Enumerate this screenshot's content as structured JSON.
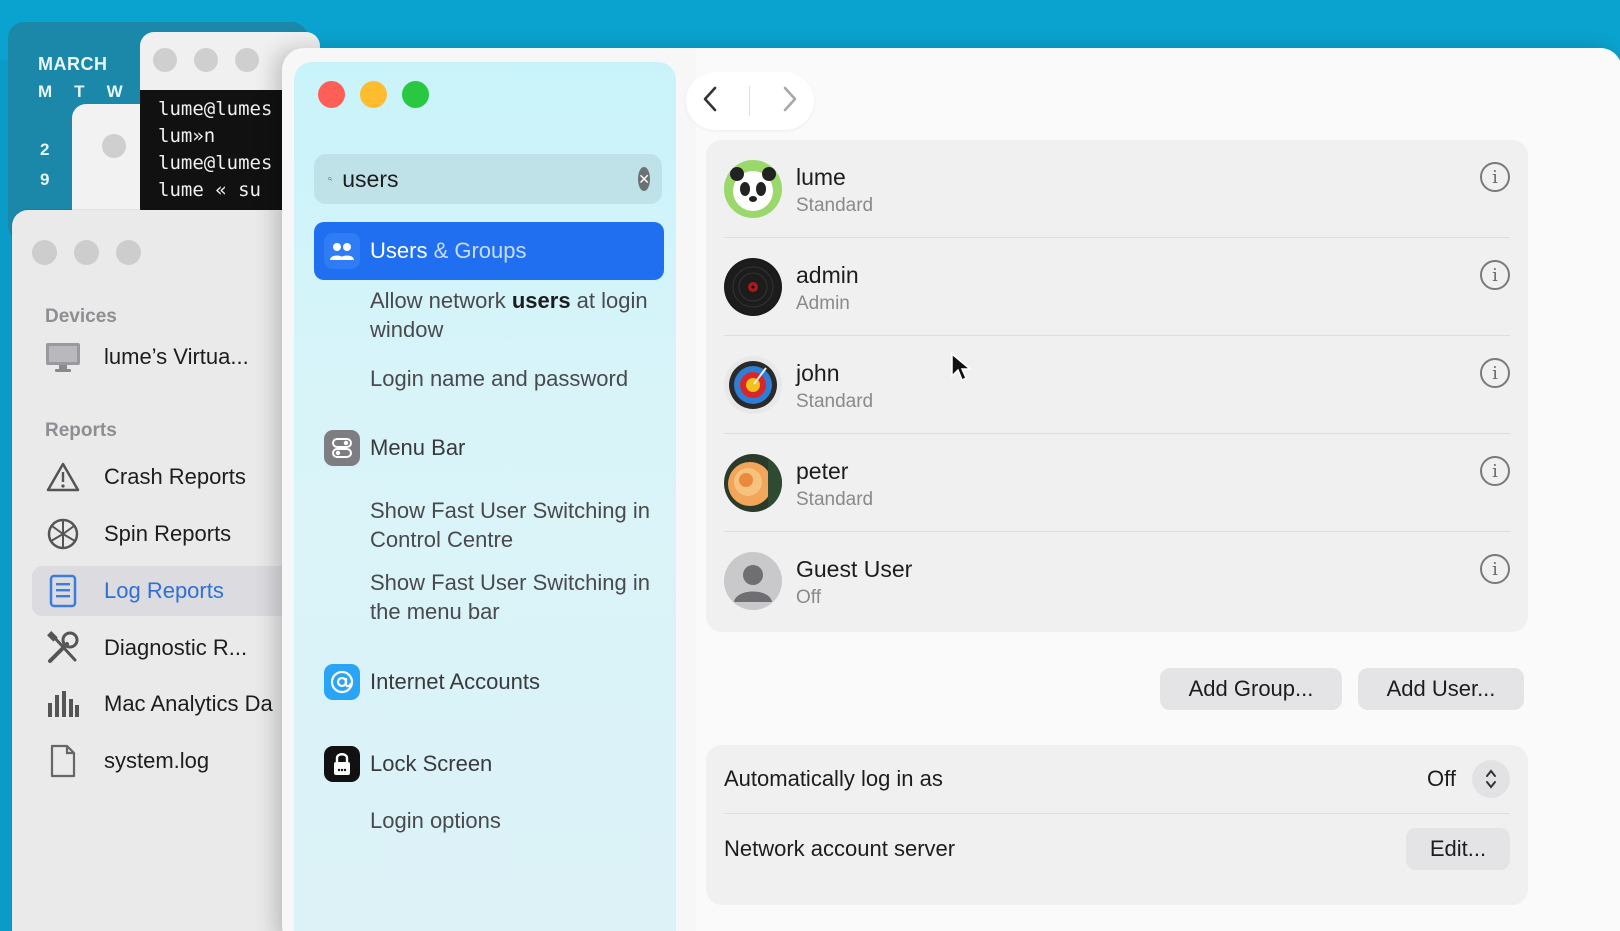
{
  "calendar": {
    "month": "MARCH",
    "weekdays": [
      "M",
      "T",
      "W"
    ],
    "dates": [
      "2",
      "9"
    ]
  },
  "terminal": {
    "lines": [
      "lume@lumes",
      "lum»n",
      "lume@lumes",
      "lume « su"
    ]
  },
  "console": {
    "devices_heading": "Devices",
    "device_name": "lume’s Virtua...",
    "reports_heading": "Reports",
    "items": [
      {
        "label": "Crash Reports",
        "icon": "warning-icon"
      },
      {
        "label": "Spin Reports",
        "icon": "spin-icon"
      },
      {
        "label": "Log Reports",
        "icon": "log-icon"
      },
      {
        "label": "Diagnostic R...",
        "icon": "tools-icon"
      },
      {
        "label": "Mac Analytics Da",
        "icon": "analytics-icon"
      },
      {
        "label": "system.log",
        "icon": "file-icon"
      }
    ]
  },
  "settings": {
    "search": {
      "value": "users"
    },
    "sidebar": {
      "selected": {
        "label_a": "Users",
        "label_b": " & Groups"
      },
      "users_subitems": [
        {
          "prefix": "Allow network ",
          "bold": "users",
          "suffix": " at login window"
        },
        {
          "text": "Login name and password"
        }
      ],
      "menu_bar": "Menu Bar",
      "menu_bar_subitems": [
        "Show Fast User Switching in Control Centre",
        "Show Fast User Switching in the menu bar"
      ],
      "internet_accounts": "Internet Accounts",
      "lock_screen": "Lock Screen",
      "lock_screen_subitems": [
        "Login options"
      ]
    },
    "users": [
      {
        "name": "lume",
        "role": "Standard",
        "avatar": "panda"
      },
      {
        "name": "admin",
        "role": "Admin",
        "avatar": "record"
      },
      {
        "name": "john",
        "role": "Standard",
        "avatar": "target"
      },
      {
        "name": "peter",
        "role": "Standard",
        "avatar": "rose"
      },
      {
        "name": "Guest User",
        "role": "Off",
        "avatar": "guest"
      }
    ],
    "buttons": {
      "add_group": "Add Group...",
      "add_user": "Add User..."
    },
    "auto_login": {
      "label": "Automatically log in as",
      "value": "Off"
    },
    "network_server": {
      "label": "Network account server",
      "button": "Edit..."
    }
  },
  "colors": {
    "accent": "#1f6ff0",
    "close": "#ff5f57",
    "minimize": "#febc2e",
    "zoom": "#28c840",
    "desktop": "#0a9bc8"
  }
}
